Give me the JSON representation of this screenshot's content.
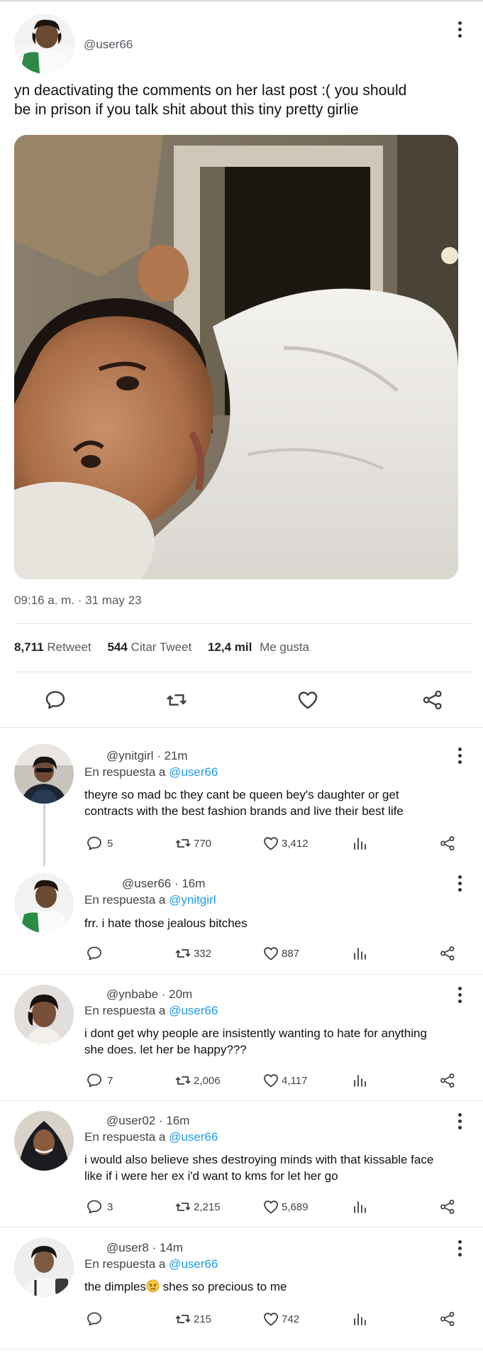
{
  "post": {
    "handle": "@user66",
    "text_line1": "yn deactivating the comments on her last post :( you should",
    "text_line2": "be in prison if you talk shit about this tiny pretty girlie",
    "photo_alt": "Selfie photo of a girl smiling, resting her head on a white pillow",
    "timestamp": "09:16 a. m. · 31 may 23",
    "stats": {
      "retweets_count": "8,711",
      "retweets_label": "Retweet",
      "quotes_count": "544",
      "quotes_label": "Citar Tweet",
      "likes_count": "12,4 mil",
      "likes_label": "Me gusta"
    }
  },
  "replies": [
    {
      "handle": "@ynitgirl · 21m",
      "reply_prefix": "En respuesta a",
      "reply_to": "@user66",
      "line1": "theyre so mad bc they cant be queen bey's daughter or get",
      "line2": "contracts with the best fashion brands and live their best life",
      "comments": "5",
      "retweets": "770",
      "likes": "3,412"
    },
    {
      "handle": "@user66 · 16m",
      "reply_prefix": "En respuesta a",
      "reply_to": "@ynitgirl",
      "line1": "frr. i hate those jealous bitches",
      "line2": "",
      "comments": "",
      "retweets": "332",
      "likes": "887"
    },
    {
      "handle": "@ynbabe · 20m",
      "reply_prefix": "En respuesta a",
      "reply_to": "@user66",
      "line1": "i dont get why people are insistently wanting to hate for anything",
      "line2": "she does. let her be happy???",
      "comments": "7",
      "retweets": "2,006",
      "likes": "4,117"
    },
    {
      "handle": "@user02 · 16m",
      "reply_prefix": "En respuesta a",
      "reply_to": "@user66",
      "line1": "i would also believe shes destroying minds with that kissable face",
      "line2": "like if i were her ex i'd want to kms for let her go",
      "comments": "3",
      "retweets": "2,215",
      "likes": "5,689"
    },
    {
      "handle": "@user8 · 14m",
      "reply_prefix": "En respuesta a",
      "reply_to": "@user66",
      "line1a": "the dimples",
      "line1b": " shes so precious to me",
      "comments": "",
      "retweets": "215",
      "likes": "742"
    }
  ],
  "icons": {
    "comment": "comment-icon",
    "retweet": "retweet-icon",
    "like": "heart-icon",
    "share": "share-icon",
    "analytics": "analytics-icon",
    "more": "more-options-icon",
    "emoji": "worried-face-emoji"
  },
  "colors": {
    "link": "#1d9bf0",
    "divider": "#e3e5e8",
    "text": "#14171a",
    "muted": "#555b61"
  }
}
